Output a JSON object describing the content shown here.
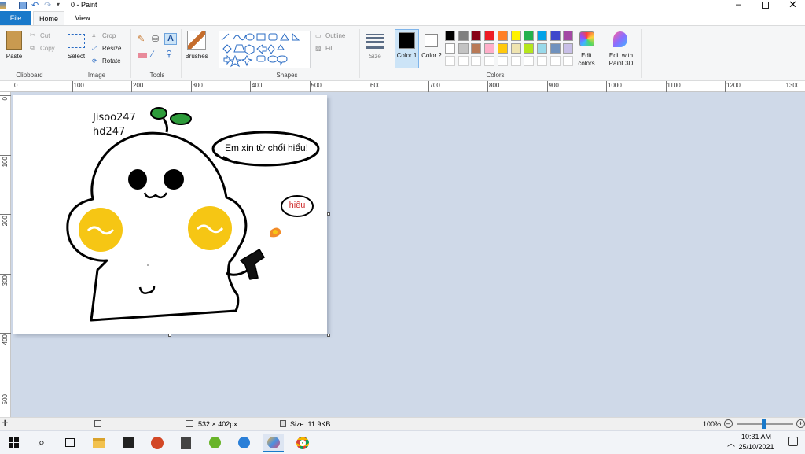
{
  "window": {
    "title": "0 - Paint"
  },
  "tabs": [
    {
      "label": "File"
    },
    {
      "label": "Home"
    },
    {
      "label": "View"
    }
  ],
  "ribbon": {
    "clipboard": {
      "group": "Clipboard",
      "paste": "Paste",
      "cut": "Cut",
      "copy": "Copy"
    },
    "image": {
      "group": "Image",
      "select": "Select",
      "crop": "Crop",
      "resize": "Resize",
      "rotate": "Rotate"
    },
    "tools": {
      "group": "Tools"
    },
    "brushes": {
      "label": "Brushes"
    },
    "shapes": {
      "group": "Shapes",
      "outline": "Outline",
      "fill": "Fill"
    },
    "size": {
      "label": "Size"
    },
    "colors": {
      "group": "Colors",
      "color1": "Color 1",
      "color2": "Color 2",
      "edit_colors": "Edit colors",
      "edit_3d": "Edit with Paint 3D",
      "color1_value": "#000000",
      "color2_value": "#ffffff",
      "palette": [
        "#000000",
        "#7f7f7f",
        "#880015",
        "#ed1c24",
        "#ff7f27",
        "#fff200",
        "#22b14c",
        "#00a2e8",
        "#3f48cc",
        "#a349a4",
        "#ffffff",
        "#c3c3c3",
        "#b97a57",
        "#ffaec9",
        "#ffc90e",
        "#efe4b0",
        "#b5e61d",
        "#99d9ea",
        "#7092be",
        "#c8bfe7"
      ]
    }
  },
  "ruler": {
    "h_ticks": [
      "0",
      "100",
      "200",
      "300",
      "400",
      "500",
      "600",
      "700",
      "800",
      "900",
      "1000",
      "1100",
      "1200",
      "1300"
    ],
    "v_ticks": [
      "0",
      "100",
      "200",
      "300",
      "400",
      "500"
    ]
  },
  "drawing": {
    "text_line1": "Jisoo247",
    "text_line2": "hd247",
    "bubble_text": "Em xin từ chối hiểu!",
    "small_bubble_text": "hiểu"
  },
  "status": {
    "dimensions": "532 × 402px",
    "size": "Size: 11.9KB",
    "zoom": "100%"
  },
  "taskbar": {
    "time": "10:31 AM",
    "date": "25/10/2021"
  }
}
